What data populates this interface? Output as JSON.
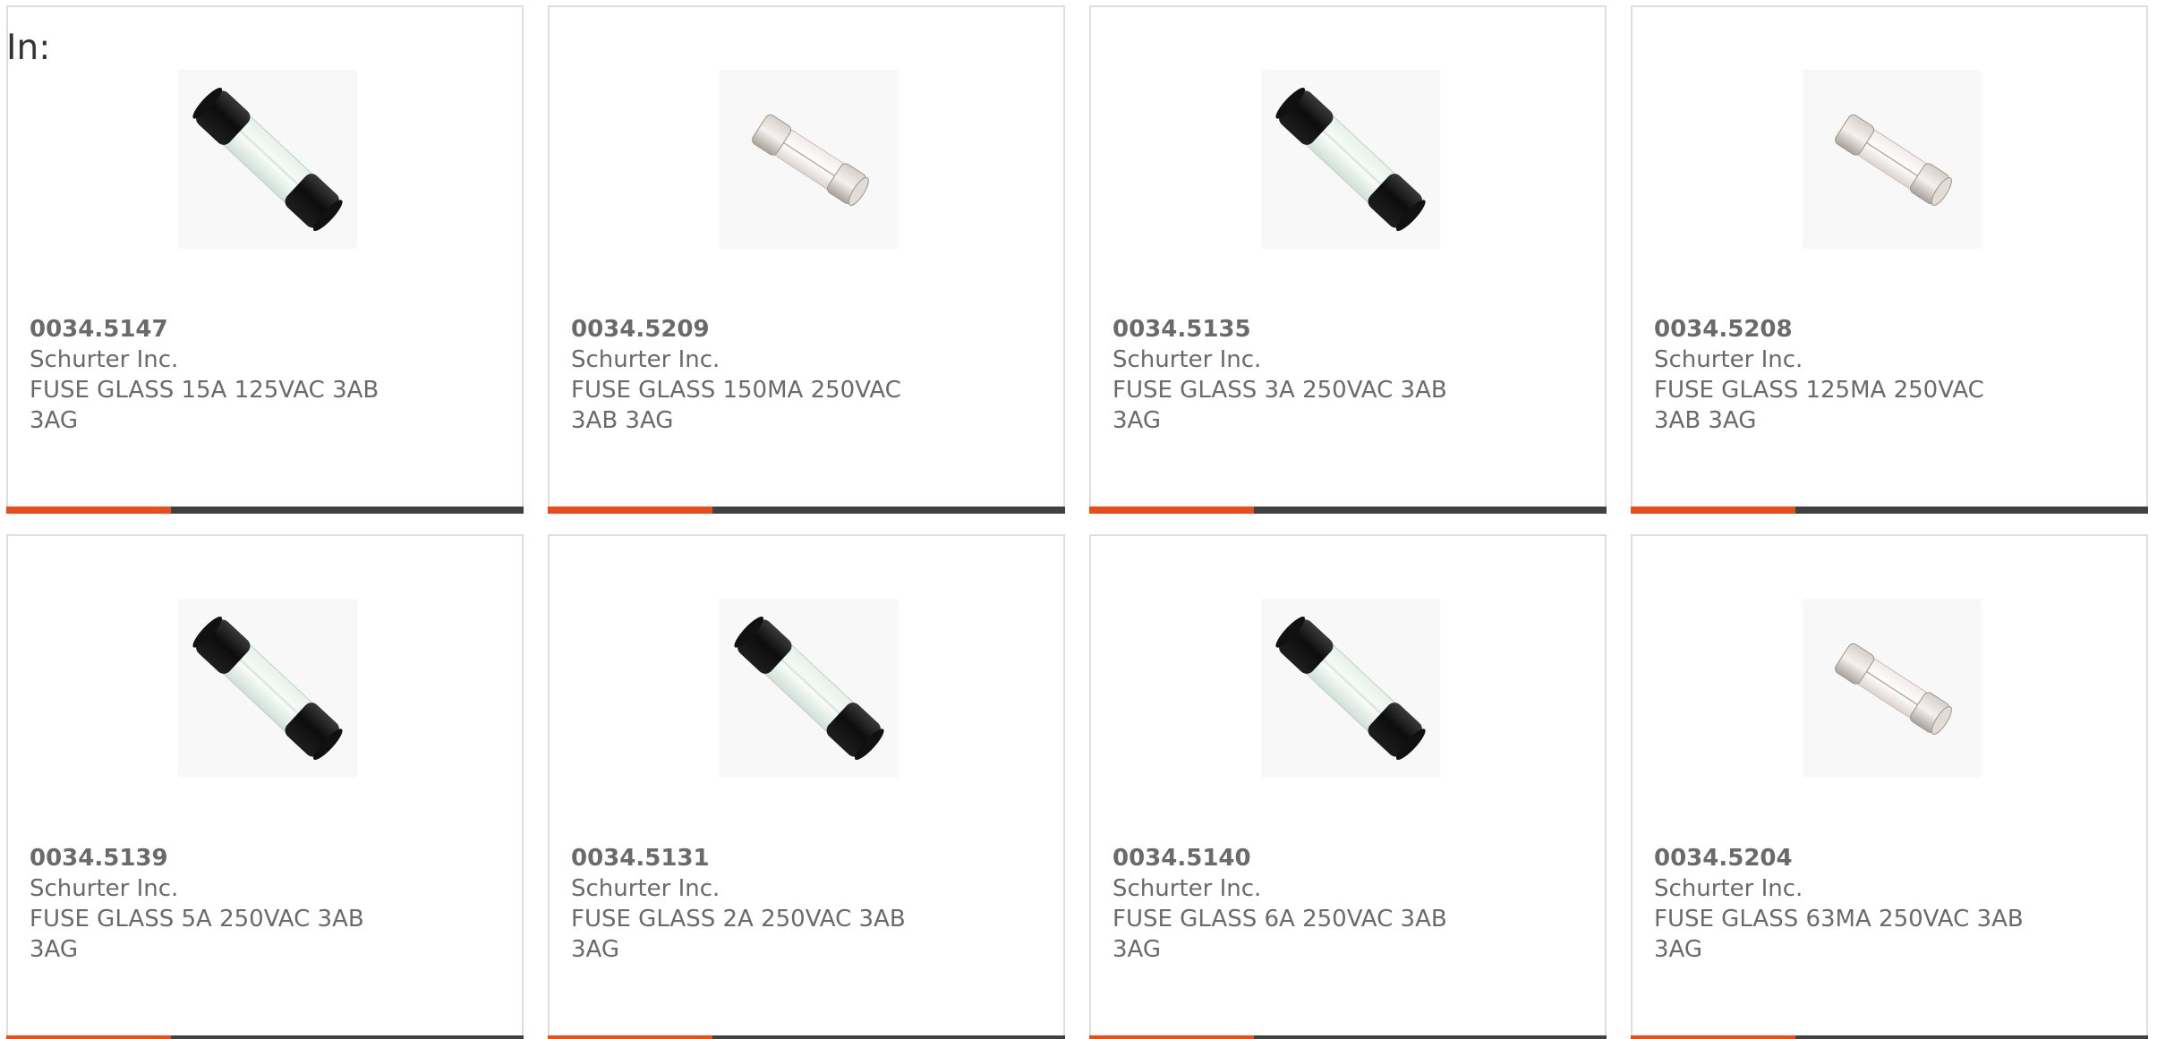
{
  "heading": "In:",
  "colors": {
    "accent": "#e84e1b",
    "bar": "#414141",
    "border": "#dedede",
    "text": "#6a6a6a"
  },
  "products": [
    {
      "part_number": "0034.5147",
      "manufacturer": "Schurter Inc.",
      "description": "FUSE GLASS 15A 125VAC 3AB 3AG",
      "image": "black-cap-fuse-icon"
    },
    {
      "part_number": "0034.5209",
      "manufacturer": "Schurter Inc.",
      "description": "FUSE GLASS 150MA 250VAC 3AB 3AG",
      "image": "silver-cap-fuse-icon"
    },
    {
      "part_number": "0034.5135",
      "manufacturer": "Schurter Inc.",
      "description": "FUSE GLASS 3A 250VAC 3AB 3AG",
      "image": "black-cap-fuse-icon"
    },
    {
      "part_number": "0034.5208",
      "manufacturer": "Schurter Inc.",
      "description": "FUSE GLASS 125MA 250VAC 3AB 3AG",
      "image": "silver-cap-fuse-icon"
    },
    {
      "part_number": "0034.5139",
      "manufacturer": "Schurter Inc.",
      "description": "FUSE GLASS 5A 250VAC 3AB 3AG",
      "image": "black-cap-fuse-icon"
    },
    {
      "part_number": "0034.5131",
      "manufacturer": "Schurter Inc.",
      "description": "FUSE GLASS 2A 250VAC 3AB 3AG",
      "image": "black-cap-fuse-icon"
    },
    {
      "part_number": "0034.5140",
      "manufacturer": "Schurter Inc.",
      "description": "FUSE GLASS 6A 250VAC 3AB 3AG",
      "image": "black-cap-fuse-icon"
    },
    {
      "part_number": "0034.5204",
      "manufacturer": "Schurter Inc.",
      "description": "FUSE GLASS 63MA 250VAC 3AB 3AG",
      "image": "silver-cap-fuse-icon"
    }
  ]
}
